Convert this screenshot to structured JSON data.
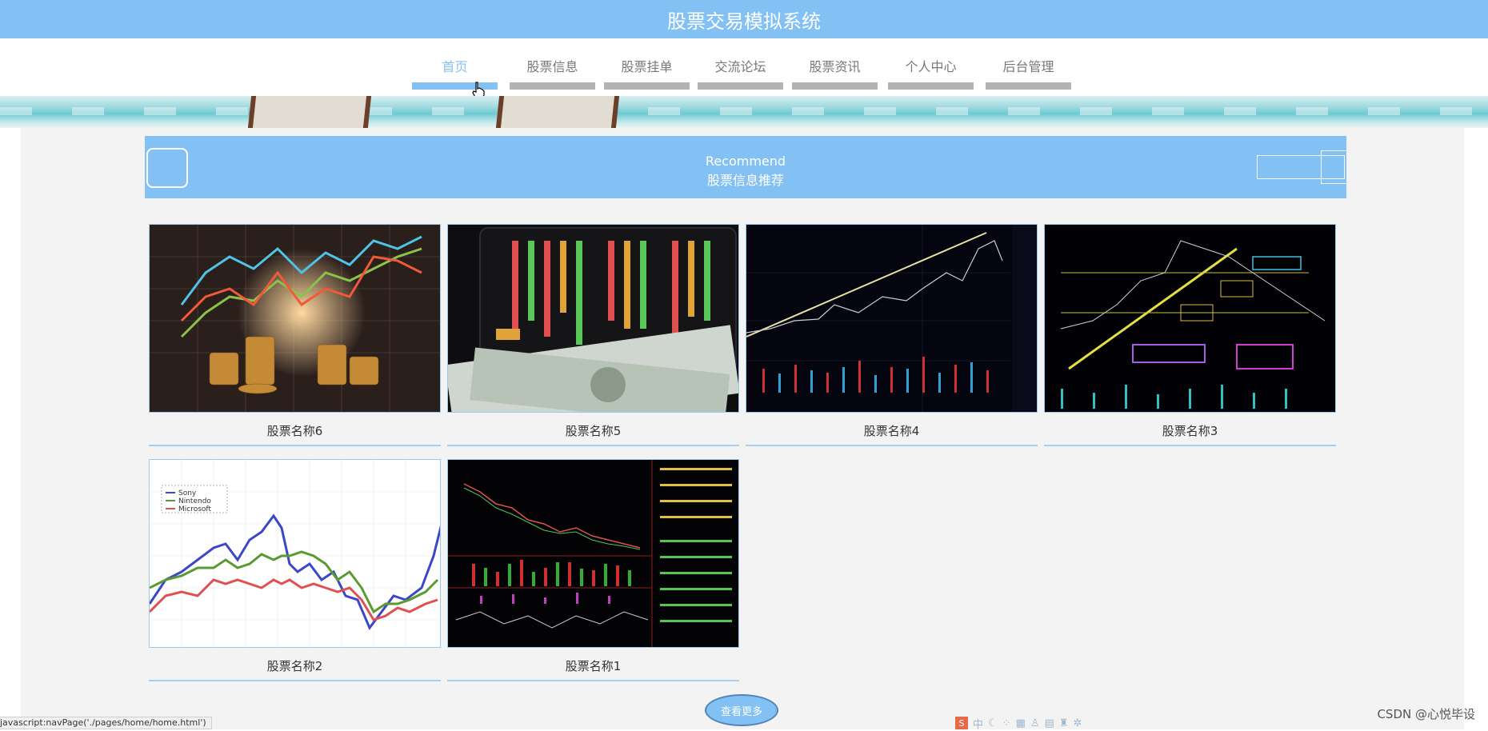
{
  "header": {
    "title": "股票交易模拟系统"
  },
  "nav": {
    "items": [
      {
        "label": "首页",
        "active": true
      },
      {
        "label": "股票信息",
        "active": false
      },
      {
        "label": "股票挂单",
        "active": false
      },
      {
        "label": "交流论坛",
        "active": false
      },
      {
        "label": "股票资讯",
        "active": false
      },
      {
        "label": "个人中心",
        "active": false
      },
      {
        "label": "后台管理",
        "active": false
      }
    ]
  },
  "section": {
    "title_en": "Recommend",
    "title_cn": "股票信息推荐"
  },
  "cards": [
    {
      "name": "股票名称6",
      "image": "coins-chart-image"
    },
    {
      "name": "股票名称5",
      "image": "tablet-dollars-image"
    },
    {
      "name": "股票名称4",
      "image": "candlestick-chart-image"
    },
    {
      "name": "股票名称3",
      "image": "annotated-chart-image"
    },
    {
      "name": "股票名称2",
      "image": "line-chart-image"
    },
    {
      "name": "股票名称1",
      "image": "trading-screen-image"
    }
  ],
  "line_chart_legend": [
    "Sony",
    "Nintendo",
    "Microsoft"
  ],
  "more_button": {
    "label": "查看更多"
  },
  "status_bar": {
    "url": "javascript:navPage('./pages/home/home.html')"
  },
  "tray": {
    "brand": "S",
    "lang": "中"
  },
  "watermark": "CSDN @心悦毕设",
  "colors": {
    "accent": "#83c1f5",
    "nav_bar_inactive": "#b3b3b3",
    "main_bg": "#f3f3f3"
  }
}
